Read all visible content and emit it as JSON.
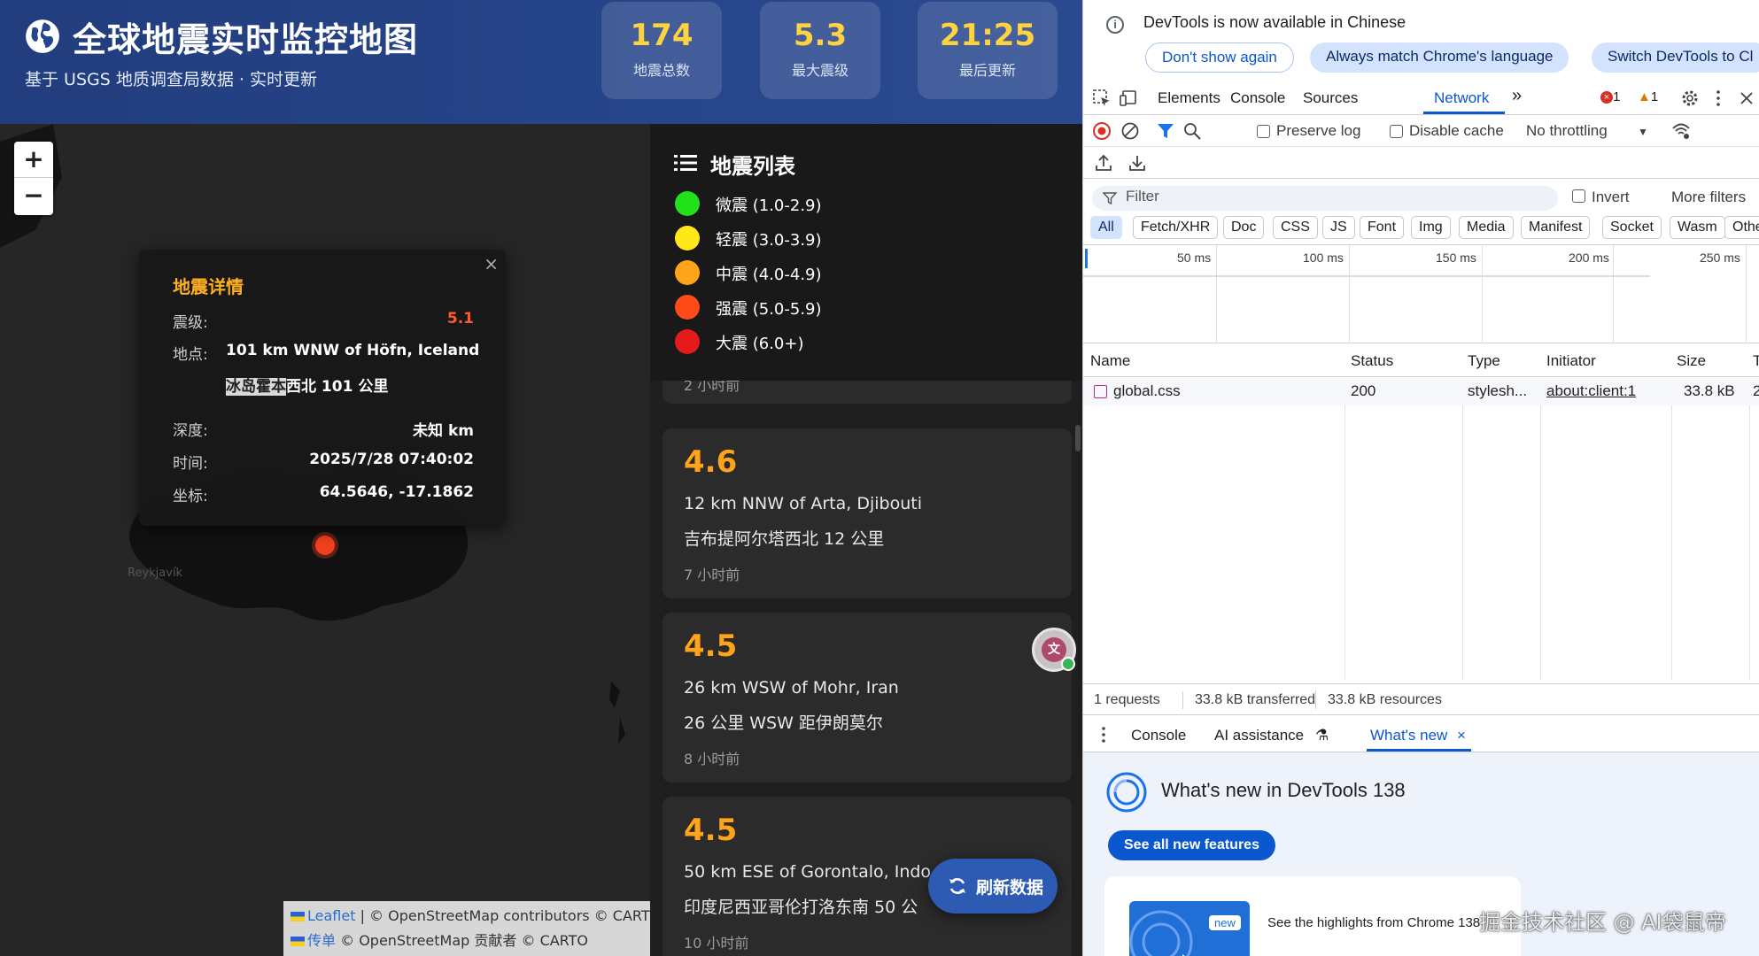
{
  "app": {
    "title": "全球地震实时监控地图",
    "subtitle": "基于 USGS 地质调查局数据 · 实时更新",
    "stats": [
      {
        "value": "174",
        "label": "地震总数"
      },
      {
        "value": "5.3",
        "label": "最大震级"
      },
      {
        "value": "21:25",
        "label": "最后更新"
      }
    ],
    "accent_color": "#ffd23f",
    "header_color": "#27458a"
  },
  "map": {
    "zoom_in": "+",
    "zoom_out": "−",
    "city_label": "Reykjavík",
    "popup": {
      "title": "地震详情",
      "close": "×",
      "magnitude_label": "震级:",
      "magnitude": "5.1",
      "location_label": "地点:",
      "location_en": "101 km WNW of Höfn, Iceland",
      "location_zh_highlight": "冰岛霍本",
      "location_zh_rest": "西北 101 公里",
      "depth_label": "深度:",
      "depth": "未知 km",
      "time_label": "时间:",
      "time": "2025/7/28 07:40:02",
      "coords_label": "坐标:",
      "coords": "64.5646, -17.1862"
    },
    "attribution": {
      "line1_link": "Leaflet",
      "line1_text": " | © OpenStreetMap contributors © CARTO",
      "line2_link": "传单",
      "line2_text": " © OpenStreetMap 贡献者 © CARTO"
    }
  },
  "sidebar": {
    "legend_title": "地震列表",
    "legend": [
      {
        "label": "微震 (1.0-2.9)",
        "color": "#22e01a"
      },
      {
        "label": "轻震 (3.0-3.9)",
        "color": "#ffe81a"
      },
      {
        "label": "中震 (4.0-4.9)",
        "color": "#ffa31a"
      },
      {
        "label": "强震 (5.0-5.9)",
        "color": "#ff4a1a"
      },
      {
        "label": "大震 (6.0+)",
        "color": "#e61a1a"
      }
    ],
    "cards": [
      {
        "time": "2 小时前"
      },
      {
        "mag": "4.6",
        "en": "12 km NNW of Arta, Djibouti",
        "zh": "吉布提阿尔塔西北 12 公里",
        "time": "7 小时前"
      },
      {
        "mag": "4.5",
        "en": "26 km WSW of Mohr, Iran",
        "zh": "26 公里 WSW 距伊朗莫尔",
        "time": "8 小时前"
      },
      {
        "mag": "4.5",
        "en": "50 km ESE of Gorontalo, Indo",
        "zh": "印度尼西亚哥伦打洛东南 50 公",
        "time": "10 小时前"
      }
    ],
    "refresh_label": "刷新数据",
    "translate_icon": "translate-icon"
  },
  "devtools": {
    "notice": "DevTools is now available in Chinese",
    "btn_dont_show": "Don't show again",
    "btn_match_lang": "Always match Chrome's language",
    "btn_switch": "Switch DevTools to Cl",
    "tabs": [
      "Elements",
      "Console",
      "Sources",
      "Network"
    ],
    "more_tabs": "»",
    "errors": "1",
    "warnings": "1",
    "preserve_log": "Preserve log",
    "disable_cache": "Disable cache",
    "throttling": "No throttling",
    "filter_placeholder": "Filter",
    "invert": "Invert",
    "more_filters": "More filters",
    "types": [
      "All",
      "Fetch/XHR",
      "Doc",
      "CSS",
      "JS",
      "Font",
      "Img",
      "Media",
      "Manifest",
      "Socket",
      "Wasm",
      "Other"
    ],
    "timeline": [
      "50 ms",
      "100 ms",
      "150 ms",
      "200 ms",
      "250 ms"
    ],
    "columns": [
      "Name",
      "Status",
      "Type",
      "Initiator",
      "Size",
      "T"
    ],
    "row": {
      "name": "global.css",
      "status": "200",
      "type": "stylesh...",
      "initiator": "about:client:1",
      "size": "33.8 kB",
      "time": "2"
    },
    "status_bar": [
      "1 requests",
      "33.8 kB transferred",
      "33.8 kB resources"
    ],
    "drawer_tabs": [
      "Console",
      "AI assistance",
      "What's new"
    ],
    "whats_new_title": "What's new in DevTools 138",
    "whats_new_button": "See all new features",
    "new_badge": "new",
    "highlights": "See the highlights from Chrome 138"
  },
  "watermark": "掘金技术社区 @ AI袋鼠帝"
}
